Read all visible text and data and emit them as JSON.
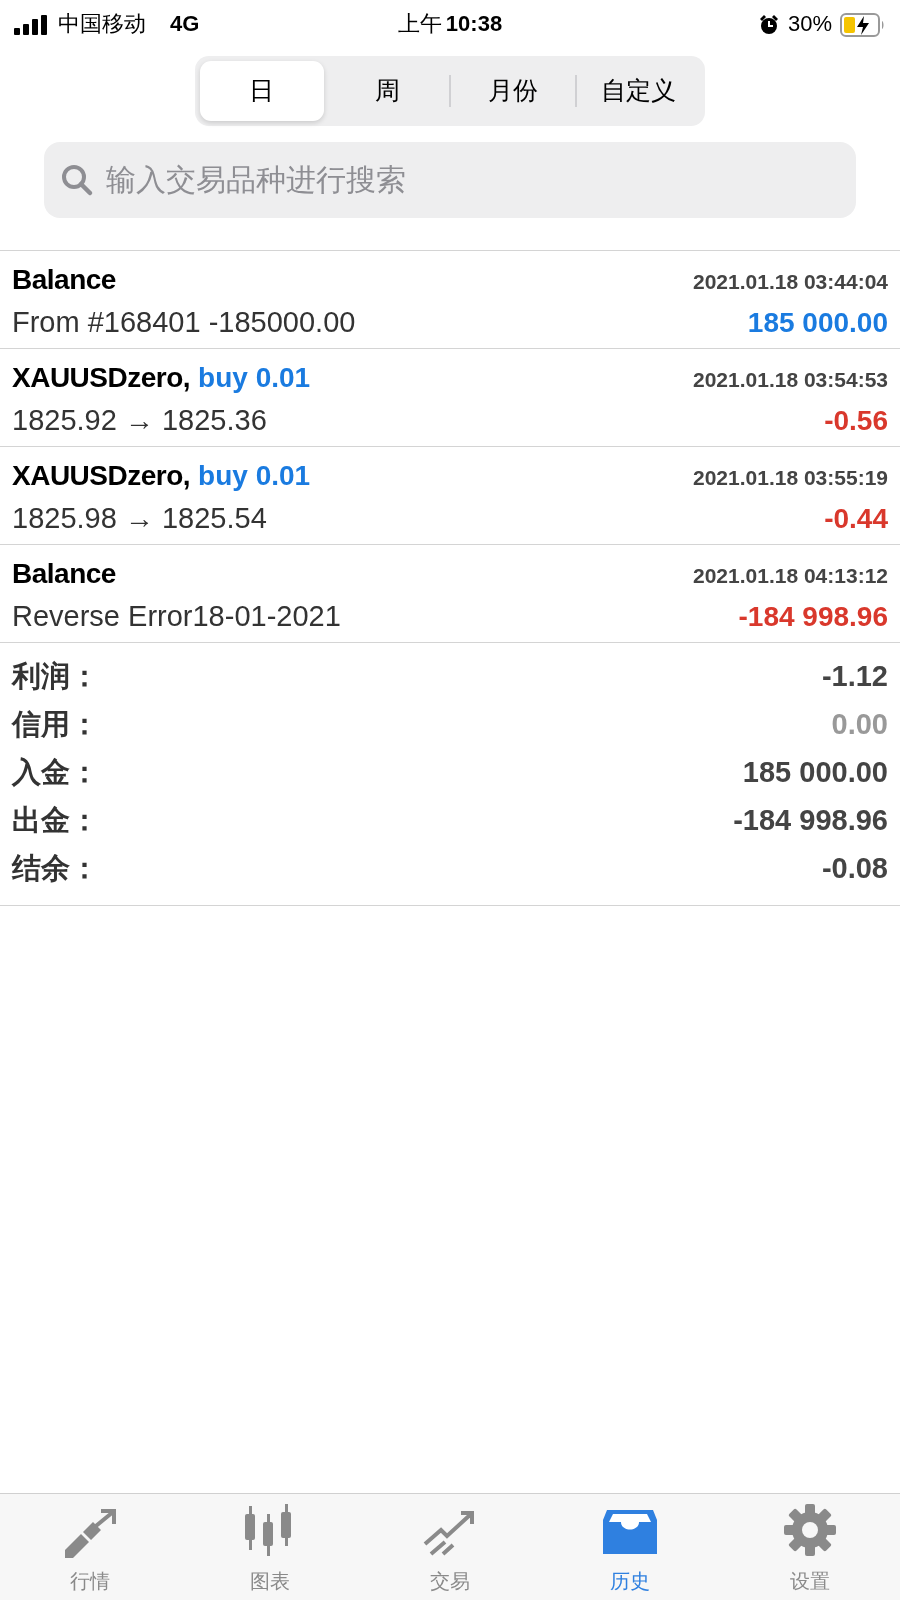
{
  "status_bar": {
    "carrier": "中国移动",
    "network": "4G",
    "time_period": "上午",
    "time": "10:38",
    "battery": "30%"
  },
  "period_tabs": [
    {
      "label": "日",
      "selected": true
    },
    {
      "label": "周",
      "selected": false
    },
    {
      "label": "月份",
      "selected": false
    },
    {
      "label": "自定义",
      "selected": false
    }
  ],
  "search": {
    "placeholder": "输入交易品种进行搜索"
  },
  "deals": [
    {
      "kind": "balance",
      "title": "Balance",
      "time": "2021.01.18 03:44:04",
      "description": "From #168401 -185000.00",
      "amount": "185 000.00",
      "color": "#1a7be0"
    },
    {
      "kind": "trade",
      "title": "XAUUSDzero,",
      "side": "buy 0.01",
      "time": "2021.01.18 03:54:53",
      "description": "1825.92 → 1825.36",
      "amount": "-0.56",
      "color": "#d9382c"
    },
    {
      "kind": "trade",
      "title": "XAUUSDzero,",
      "side": "buy 0.01",
      "time": "2021.01.18 03:55:19",
      "description": "1825.98 → 1825.54",
      "amount": "-0.44",
      "color": "#d9382c"
    },
    {
      "kind": "balance",
      "title": "Balance",
      "time": "2021.01.18 04:13:12",
      "description": "Reverse Error18-01-2021",
      "amount": "-184 998.96",
      "color": "#d9382c"
    }
  ],
  "summary": [
    {
      "label": "利润：",
      "value": "-1.12",
      "muted": false
    },
    {
      "label": "信用：",
      "value": "0.00",
      "muted": true
    },
    {
      "label": "入金：",
      "value": "185 000.00",
      "muted": false
    },
    {
      "label": "出金：",
      "value": "-184 998.96",
      "muted": false
    },
    {
      "label": "结余：",
      "value": "-0.08",
      "muted": false
    }
  ],
  "bottom_nav": [
    {
      "kind": "quotes",
      "label": "行情",
      "selected": false
    },
    {
      "kind": "chart",
      "label": "图表",
      "selected": false
    },
    {
      "kind": "trade",
      "label": "交易",
      "selected": false
    },
    {
      "kind": "history",
      "label": "历史",
      "selected": true
    },
    {
      "kind": "settings",
      "label": "设置",
      "selected": false
    }
  ]
}
